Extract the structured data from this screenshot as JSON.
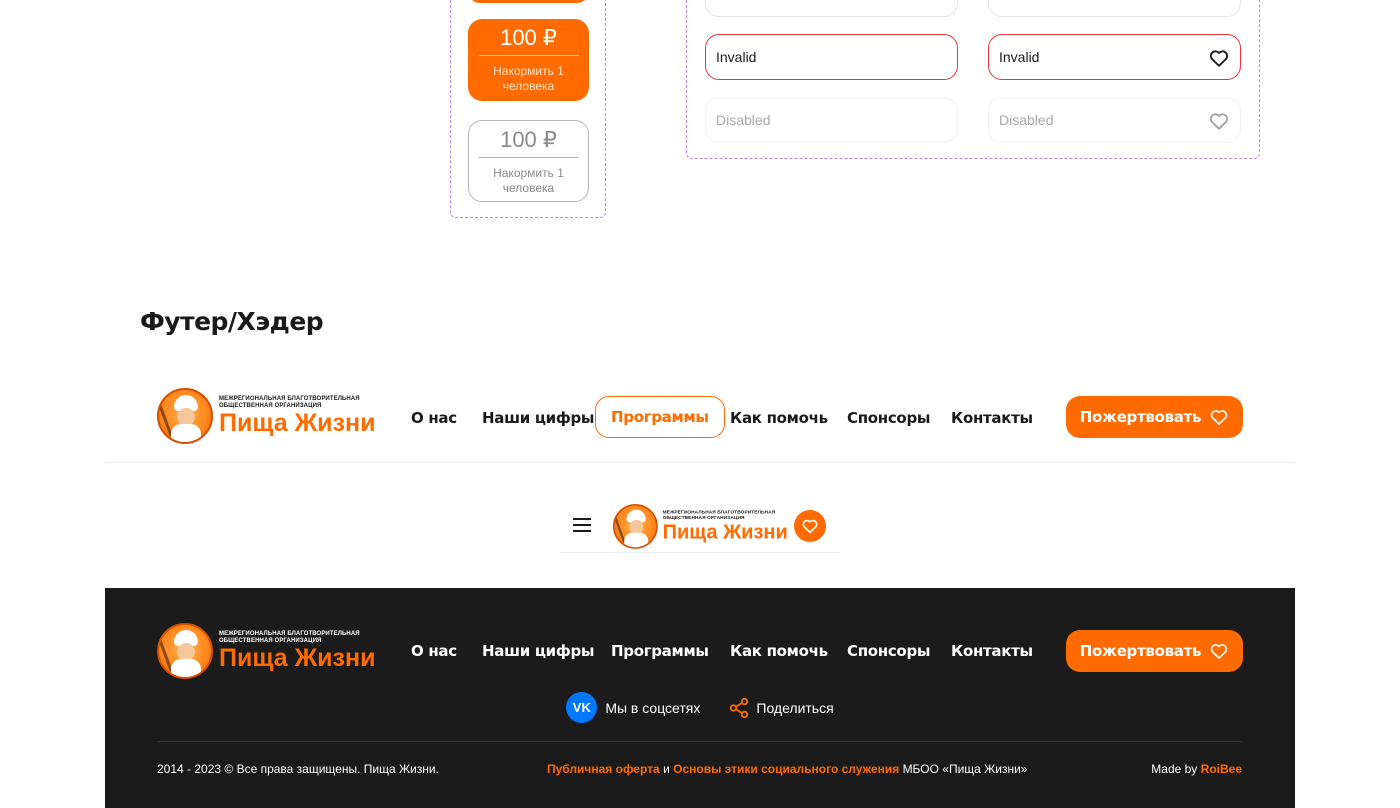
{
  "cards": {
    "filled": {
      "amount": "100 ₽",
      "description": "Накормить 1 человека"
    },
    "outline": {
      "amount": "100 ₽",
      "description": "Накормить 1 человека"
    }
  },
  "inputs": {
    "invalid_left": "Invalid",
    "invalid_right": "Invalid",
    "disabled_left": "Disabled",
    "disabled_right": "Disabled"
  },
  "section_title": "Футер/Хэдер",
  "logo": {
    "small_line1": "Межрегиональная благотворительная",
    "small_line2": "общественная организация",
    "name": "Пища Жизни"
  },
  "nav": {
    "about": "О нас",
    "numbers": "Наши цифры",
    "programs": "Программы",
    "help": "Как помочь",
    "sponsors": "Спонсоры",
    "contacts": "Контакты"
  },
  "donate_label": "Пожертвовать",
  "footer": {
    "social_label": "Мы в соцсетях",
    "vk_label": "VK",
    "share_label": "Поделиться",
    "copyright": "2014 - 2023 © Все права защищены. Пища Жизни.",
    "offer_link": "Публичная оферта",
    "and": "и",
    "ethics_link": "Основы этики социального служения",
    "org": "МБОО «Пища Жизни»",
    "made_by": "Made by",
    "studio": "RoiBee"
  },
  "colors": {
    "accent": "#ff6b00",
    "error": "#e8333c",
    "footer_bg": "#1b1b1b",
    "vk": "#0077ff"
  }
}
